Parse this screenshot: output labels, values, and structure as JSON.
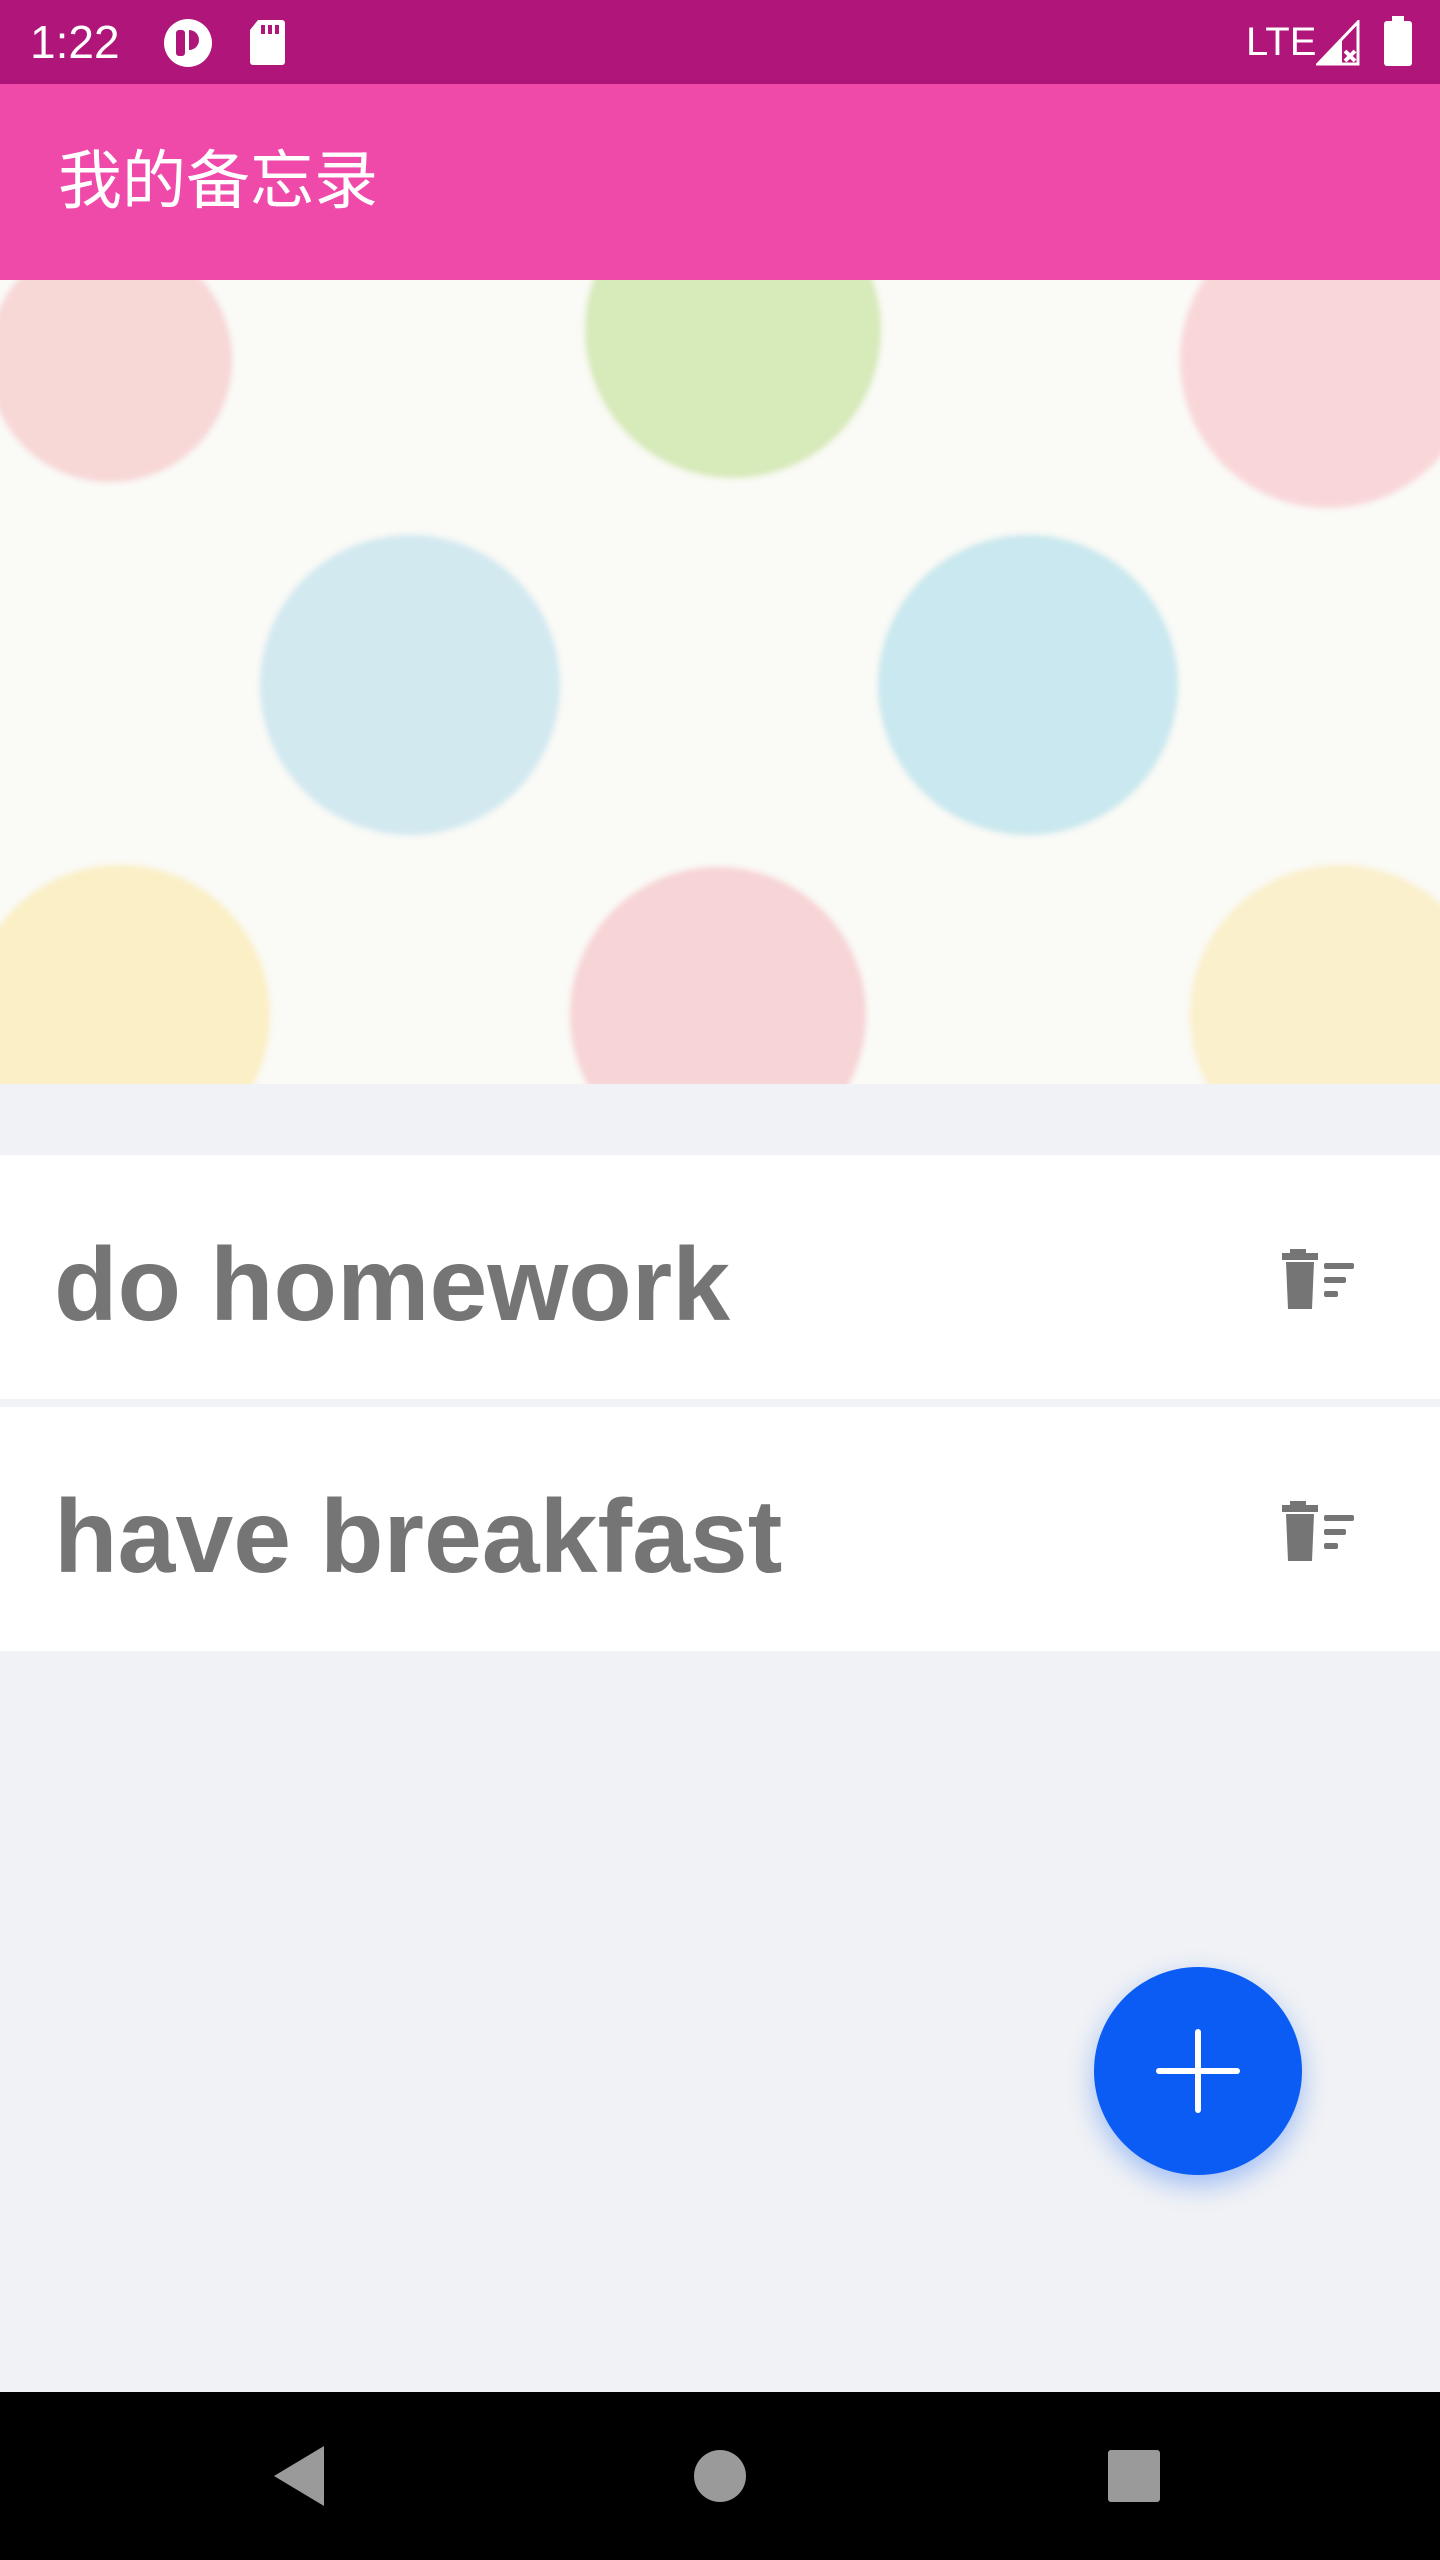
{
  "status_bar": {
    "time": "1:22",
    "network": "LTE",
    "icons": [
      "cellular-activity-icon",
      "sd-card-icon",
      "signal-icon",
      "battery-icon"
    ]
  },
  "app_bar": {
    "title": "我的备忘录"
  },
  "banner": {
    "description_icon": "polka-dot-banner"
  },
  "memos": [
    {
      "text": "do homework",
      "delete_icon": "trash-delete-icon"
    },
    {
      "text": "have breakfast",
      "delete_icon": "trash-delete-icon"
    }
  ],
  "fab": {
    "icon": "plus-icon"
  },
  "nav_bar": {
    "icons": [
      "back-icon",
      "home-icon",
      "recents-icon"
    ]
  },
  "colors": {
    "status_bar": "#b0167a",
    "app_bar": "#ef4aa9",
    "background": "#f0f2f5",
    "memo_text": "#757575",
    "fab": "#0a5cf5"
  }
}
